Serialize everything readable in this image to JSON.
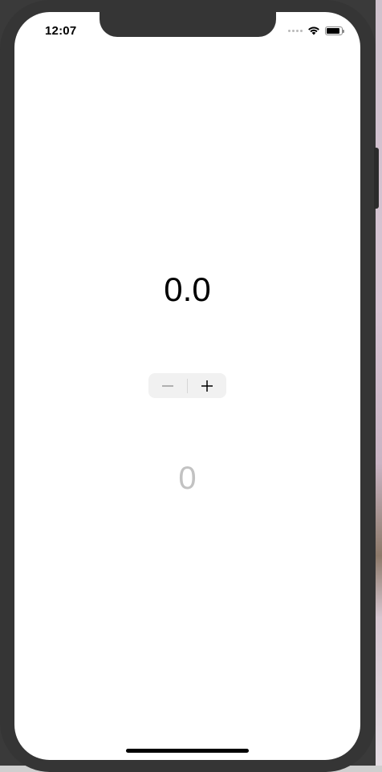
{
  "status_bar": {
    "time": "12:07",
    "signal_icon": "signal-dots-icon",
    "wifi_icon": "wifi-icon",
    "battery_icon": "battery-icon",
    "battery_level": 0.9
  },
  "main": {
    "value_label": "0.0",
    "stepper": {
      "decrement_icon": "minus-icon",
      "increment_icon": "plus-icon"
    },
    "count_label": "0"
  },
  "colors": {
    "frame": "#353535",
    "screen": "#ffffff",
    "stepper_bg": "#f1f1f1",
    "value_text": "#000000",
    "count_text": "#c2c2c2"
  }
}
